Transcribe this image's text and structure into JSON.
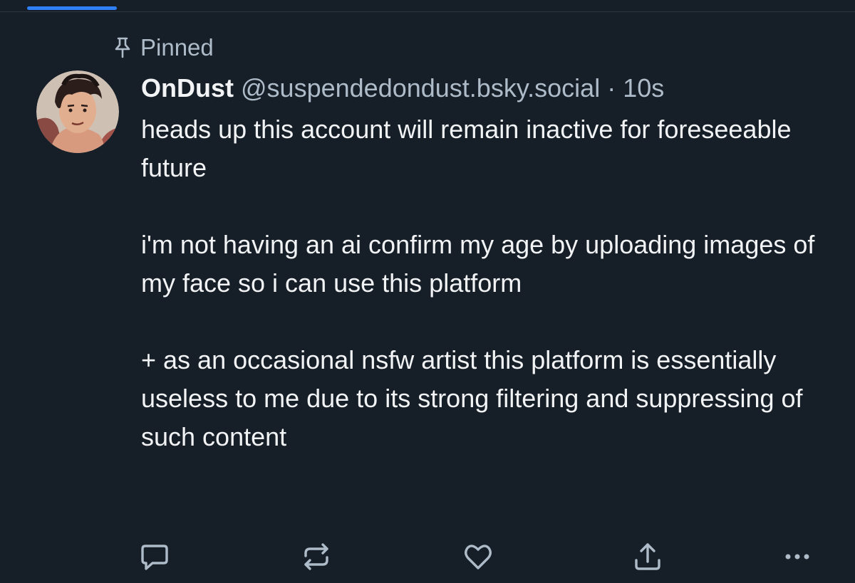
{
  "feed": {
    "active_tab_color": "#2f7ff7"
  },
  "post": {
    "pinned_label": "Pinned",
    "pinned_icon": "pin-icon",
    "author": {
      "display_name": "OnDust",
      "handle": "@suspendedondust.bsky.social",
      "avatar": "avatar-illustration"
    },
    "separator": "·",
    "timestamp": "10s",
    "paragraphs": [
      "heads up this account will remain inactive for foreseeable future",
      "i'm not having an ai confirm my age by uploading images of my face so i can use this platform",
      "+ as an occasional nsfw artist this platform is essentially useless to me due to its strong filtering and suppressing of such content"
    ],
    "actions": {
      "reply_icon": "reply-icon",
      "repost_icon": "repost-icon",
      "like_icon": "heart-icon",
      "share_icon": "share-icon",
      "more_icon": "more-icon"
    }
  },
  "colors": {
    "background": "#161e27",
    "text_primary": "#f1f3f5",
    "text_secondary": "#aebbc9",
    "accent": "#2f7ff7",
    "icon": "#aebbc9"
  }
}
